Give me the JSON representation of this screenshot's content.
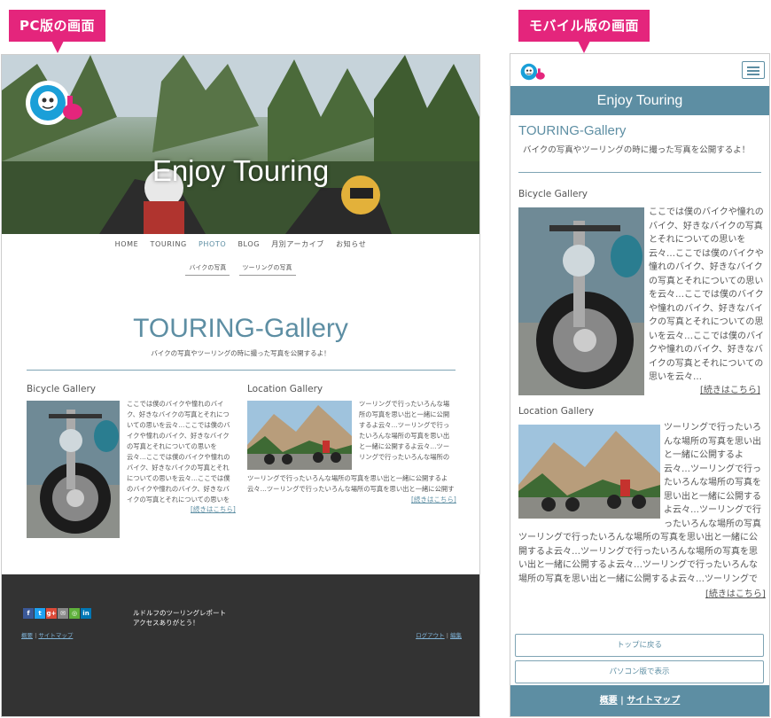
{
  "labels": {
    "pc": "PC版の画面",
    "mobile": "モバイル版の画面"
  },
  "colors": {
    "accent": "#5d8ea3",
    "tag": "#e4257c",
    "footer_dark": "#333333"
  },
  "site": {
    "title": "Enjoy Touring"
  },
  "pc": {
    "nav": [
      "HOME",
      "TOURING",
      "PHOTO",
      "BLOG",
      "月別アーカイブ",
      "お知らせ"
    ],
    "nav_active": "PHOTO",
    "subnav": [
      "バイクの写真",
      "ツーリングの写真"
    ],
    "page_title": "TOURING-Gallery",
    "page_sub": "バイクの写真やツーリングの時に撮った写真を公開するよ！",
    "bicycle": {
      "heading": "Bicycle Gallery",
      "text": "ここでは僕のバイクや憧れのバイク、好きなバイクの写真とそれについての思いを云々…ここでは僕のバイクや憧れのバイク、好きなバイクの写真とそれについての思いを云々…ここでは僕のバイクや憧れのバイク、好きなバイクの写真とそれについての思いを云々…ここでは僕のバイクや憧れのバイク、好きなバイクの写真とそれについての思いを云々…",
      "more": "[続きはこちら]"
    },
    "location": {
      "heading": "Location Gallery",
      "text": "ツーリングで行ったいろんな場所の写真を思い出と一緒に公開するよ云々…ツーリングで行ったいろんな場所の写真を思い出と一緒に公開するよ云々…ツーリングで行ったいろんな場所の写真を思い出と一緒に公開するよ云々…ツーリングで行ったいろんな場所の写真を思い出と一緒に公開するよ云々…",
      "more": "[続きはこちら]"
    },
    "footer": {
      "social": [
        "f",
        "t",
        "g+",
        "✉",
        "◎",
        "in"
      ],
      "message_line1": "ルドルフのツーリングレポート",
      "message_line2": "アクセスありがとう！",
      "link_about": "概要",
      "link_sitemap": "サイトマップ",
      "link_logout": "ログアウト",
      "link_edit": "編集",
      "sep": "|"
    }
  },
  "mobile": {
    "page_title": "TOURING-Gallery",
    "page_sub": "バイクの写真やツーリングの時に撮った写真を公開するよ！",
    "bicycle": {
      "heading": "Bicycle Gallery",
      "text": "ここでは僕のバイクや憧れのバイク、好きなバイクの写真とそれについての思いを云々…ここでは僕のバイクや憧れのバイク、好きなバイクの写真とそれについての思いを云々…ここでは僕のバイクや憧れのバイク、好きなバイクの写真とそれについての思いを云々…ここでは僕のバイクや憧れのバイク、好きなバイクの写真とそれについての思いを云々…",
      "more": "[続きはこちら]"
    },
    "location": {
      "heading": "Location Gallery",
      "text": "ツーリングで行ったいろんな場所の写真を思い出と一緒に公開するよ云々…ツーリングで行ったいろんな場所の写真を思い出と一緒に公開するよ云々…ツーリングで行ったいろんな場所の写真を思い出と一緒に公開するよ云々…ツーリングで行ったいろんな場所の写真を思い出と一緒に公開するよ云々…ツーリングで行ったいろんな場所の写真を思い出と一緒に公開するよ云々…",
      "more": "[続きはこちら]"
    },
    "btn_top": "トップに戻る",
    "btn_pc": "パソコン版で表示",
    "footer": {
      "link_about": "概要",
      "sep": "|",
      "link_sitemap": "サイトマップ"
    }
  }
}
